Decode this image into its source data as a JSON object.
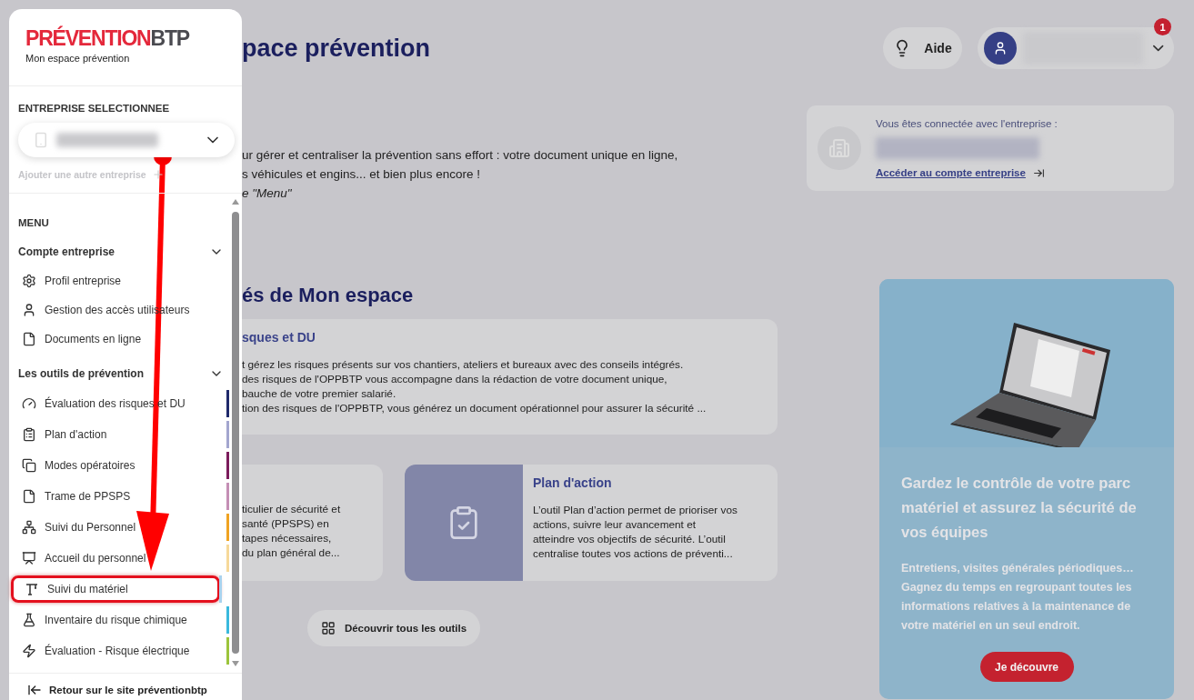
{
  "sidebar": {
    "logo": {
      "brand_main": "PRÉVENTION",
      "brand_suffix": "BTP",
      "subtitle": "Mon espace prévention"
    },
    "company_label": "ENTREPRISE SELECTIONNEE",
    "add_company": "Ajouter une autre entreprise",
    "menu_title": "MENU",
    "account_section": {
      "title": "Compte entreprise",
      "expanded": true,
      "items": [
        {
          "label": "Profil entreprise"
        },
        {
          "label": "Gestion des accès utilisateurs"
        },
        {
          "label": "Documents en ligne"
        }
      ]
    },
    "tools_section": {
      "title": "Les outils de prévention",
      "expanded": true,
      "items": [
        {
          "label": "Évaluation des risques et DU",
          "color": "#1f2a6b",
          "highlighted": false
        },
        {
          "label": "Plan d'action",
          "color": "#a3a6cf",
          "highlighted": false
        },
        {
          "label": "Modes opératoires",
          "color": "#7b1c5c",
          "highlighted": false
        },
        {
          "label": "Trame de PPSPS",
          "color": "#c48fb5",
          "highlighted": false
        },
        {
          "label": "Suivi du Personnel",
          "color": "#f0a322",
          "highlighted": false
        },
        {
          "label": "Accueil du personnel",
          "color": "#f6d99a",
          "highlighted": false
        },
        {
          "label": "Suivi du matériel",
          "color": "#a9d2ee",
          "highlighted": true
        },
        {
          "label": "Inventaire du risque chimique",
          "color": "#3ab9dd",
          "highlighted": false
        },
        {
          "label": "Évaluation - Risque électrique",
          "color": "#9cc43c",
          "highlighted": false
        }
      ]
    },
    "back_link": "Retour sur le site préventionbtp"
  },
  "header": {
    "title": "pace prévention",
    "help_button": "Aide",
    "notification_count": "1"
  },
  "intro": [
    "ur gérer et centraliser la prévention sans effort : votre document unique en ligne,",
    "s véhicules et engins... et bien plus encore !",
    "e \"Menu\""
  ],
  "connected_card": {
    "caption": "Vous êtes connectée avec l'entreprise :",
    "link": "Accéder au compte entreprise"
  },
  "tools": {
    "title": "és de Mon espace",
    "main_card": {
      "title": "sques et DU",
      "lines": [
        "t gérez les risques présents sur vos chantiers, ateliers et bureaux avec des conseils intégrés.",
        "des risques de l'OPPBTP vous accompagne dans la rédaction de votre document unique,",
        "bauche de votre premier salarié.",
        "tion des risques de l'OPPBTP, vous générez un document opérationnel pour assurer la sécurité ..."
      ]
    },
    "small_card": {
      "lines": [
        "ticulier de sécurité et",
        "santé (PPSPS) en",
        "tapes nécessaires,",
        "du plan général de..."
      ]
    },
    "action_card": {
      "title": "Plan d'action",
      "lines": [
        "L’outil Plan d’action permet de prioriser vos",
        "actions, suivre leur avancement et",
        "atteindre vos objectifs de sécurité. L’outil",
        "centralise toutes vos actions de préventi..."
      ]
    },
    "all_tools_button": "Découvrir tous les outils"
  },
  "promo": {
    "headline": "Gardez le contrôle de votre parc matériel et assurez la sécurité de vos équipes",
    "text": "Entretiens, visites générales périodiques… Gagnez du temps en regroupant toutes les informations relatives à la maintenance de votre matériel en un seul endroit.",
    "button": "Je découvre"
  }
}
